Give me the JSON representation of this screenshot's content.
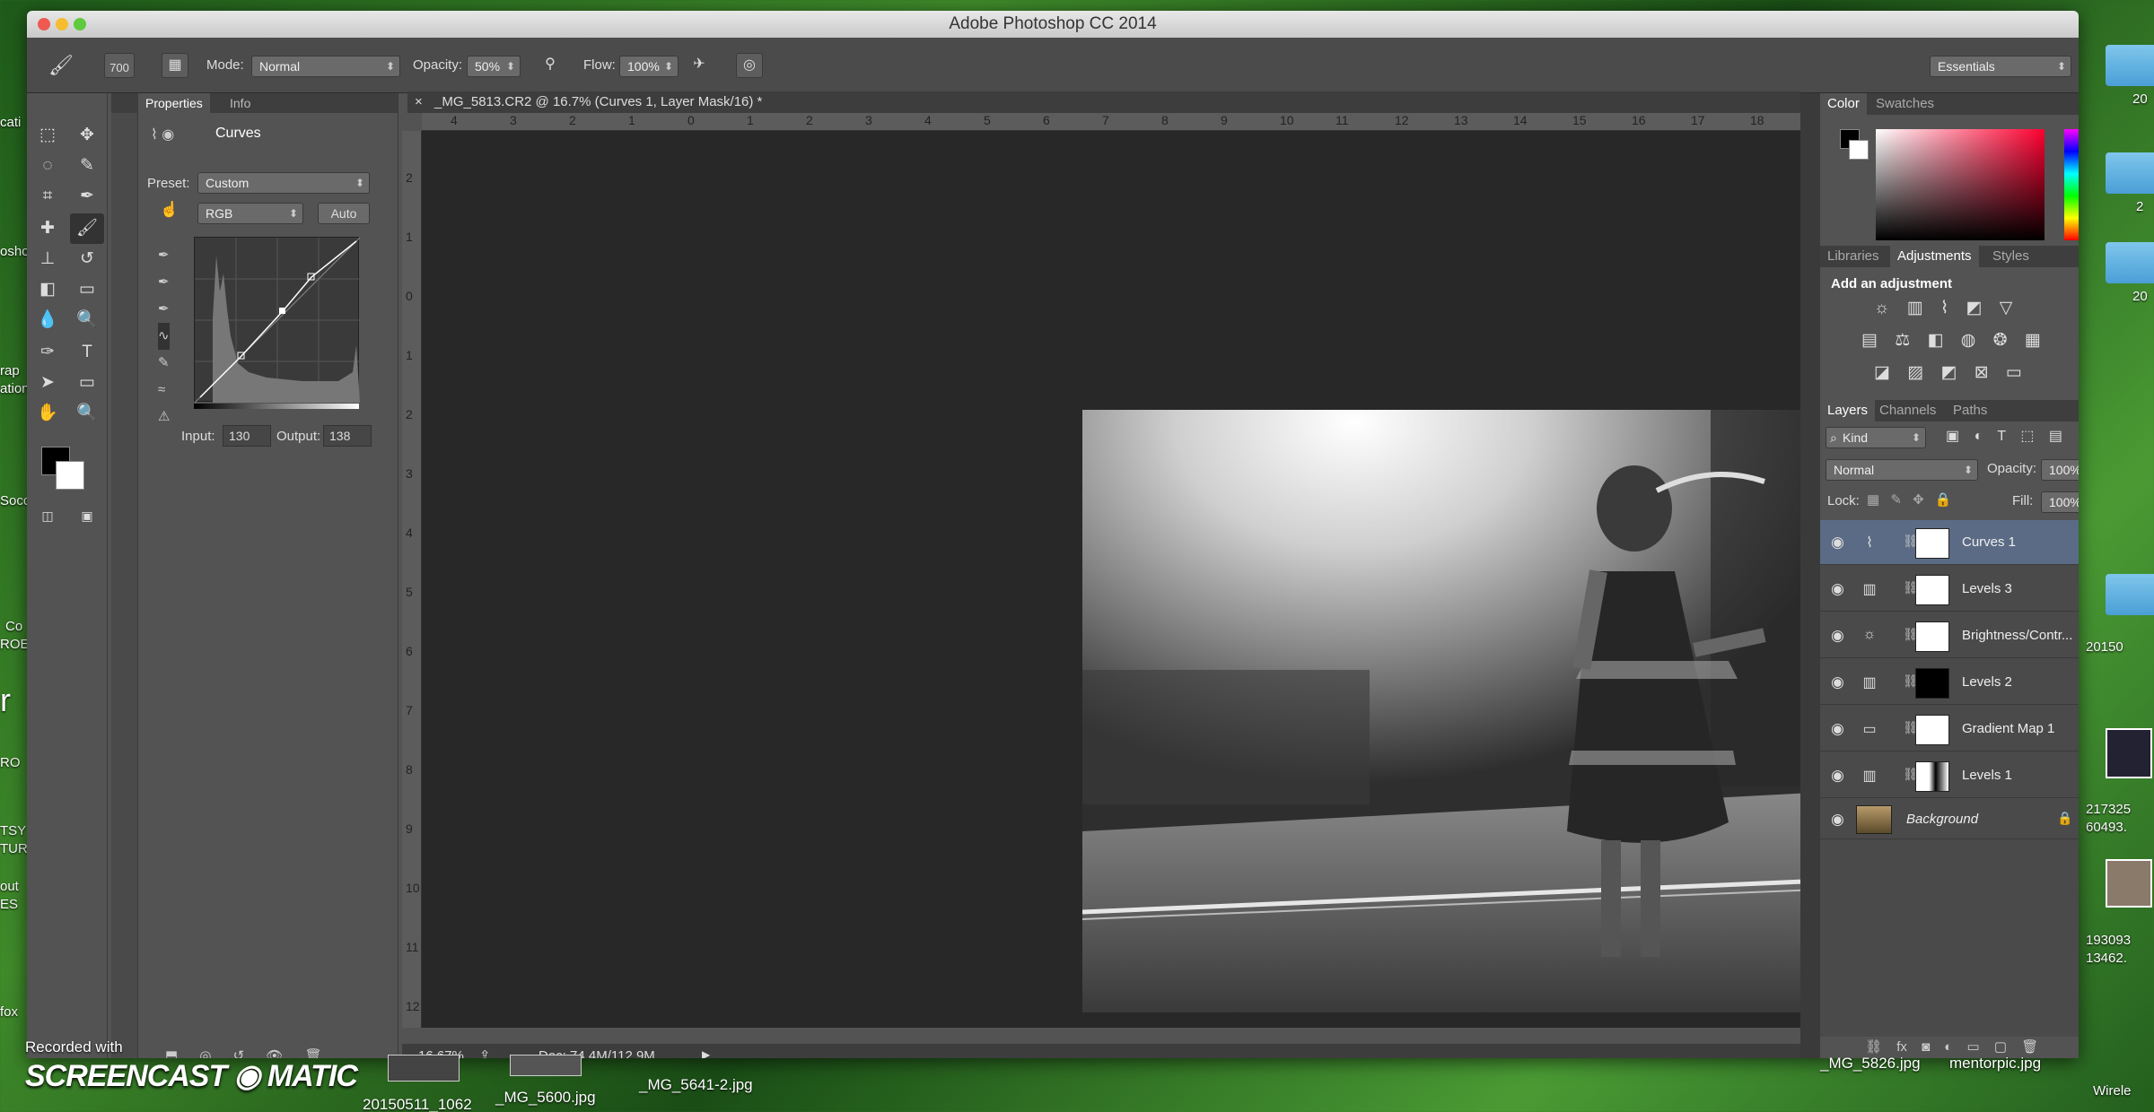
{
  "window": {
    "title": "Adobe Photoshop CC 2014"
  },
  "options_bar": {
    "brush_size": "700",
    "mode_label": "Mode:",
    "mode_value": "Normal",
    "opacity_label": "Opacity:",
    "opacity_value": "50%",
    "flow_label": "Flow:",
    "flow_value": "100%",
    "workspace": "Essentials"
  },
  "properties_panel": {
    "tabs": [
      "Properties",
      "Info"
    ],
    "header": "Curves",
    "preset_label": "Preset:",
    "preset_value": "Custom",
    "channel_value": "RGB",
    "auto_label": "Auto",
    "input_label": "Input:",
    "input_value": "130",
    "output_label": "Output:",
    "output_value": "138"
  },
  "document": {
    "tab_title": "_MG_5813.CR2 @ 16.7% (Curves 1, Layer Mask/16) *",
    "ruler_h": [
      "4",
      "3",
      "2",
      "1",
      "0",
      "1",
      "2",
      "3",
      "4",
      "5",
      "6",
      "7",
      "8",
      "9",
      "10",
      "11",
      "12",
      "13",
      "14",
      "15",
      "16",
      "17",
      "18"
    ],
    "ruler_v": [
      "2",
      "1",
      "0",
      "1",
      "2",
      "3",
      "4",
      "5",
      "6",
      "7",
      "8",
      "9",
      "10",
      "11",
      "12"
    ],
    "zoom": "16.67%",
    "doc_info": "Doc: 74.4M/112.9M"
  },
  "color_panel": {
    "tabs": [
      "Color",
      "Swatches"
    ]
  },
  "adjustments_panel": {
    "tabs": [
      "Libraries",
      "Adjustments",
      "Styles"
    ],
    "header": "Add an adjustment"
  },
  "layers_panel": {
    "tabs": [
      "Layers",
      "Channels",
      "Paths"
    ],
    "filter_value": "Kind",
    "blend_mode": "Normal",
    "opacity_label": "Opacity:",
    "opacity_value": "100%",
    "lock_label": "Lock:",
    "fill_label": "Fill:",
    "fill_value": "100%",
    "layers": [
      {
        "name": "Curves 1",
        "icon": "curves-icon",
        "selected": true
      },
      {
        "name": "Levels 3",
        "icon": "levels-icon",
        "selected": false
      },
      {
        "name": "Brightness/Contr...",
        "icon": "brightness-icon",
        "selected": false
      },
      {
        "name": "Levels 2",
        "icon": "levels-icon",
        "selected": false
      },
      {
        "name": "Gradient Map 1",
        "icon": "gradient-map-icon",
        "selected": false
      },
      {
        "name": "Levels 1",
        "icon": "levels-icon",
        "selected": false
      },
      {
        "name": "Background",
        "icon": "lock-icon",
        "selected": false
      }
    ]
  },
  "desktop": {
    "left_labels": [
      "cati",
      "osho",
      "rap",
      "ation",
      "Socc",
      "Co",
      "ROE",
      "r",
      "RO",
      "TSY",
      "TURE",
      "out",
      "ES",
      "fox"
    ],
    "right_labels": [
      "20",
      "2",
      "20",
      "20150",
      "217325",
      "60493.",
      "193093",
      "13462.",
      "Wirele"
    ],
    "taskbar_files": [
      "20150511_1062",
      "_MG_5600.jpg",
      "_MG_5641-2.jpg",
      "_MG_5826.jpg",
      "mentorpic.jpg"
    ]
  },
  "screencast": {
    "recorded_label": "Recorded with",
    "logo_text": "SCREENCAST ◉ MATIC"
  }
}
